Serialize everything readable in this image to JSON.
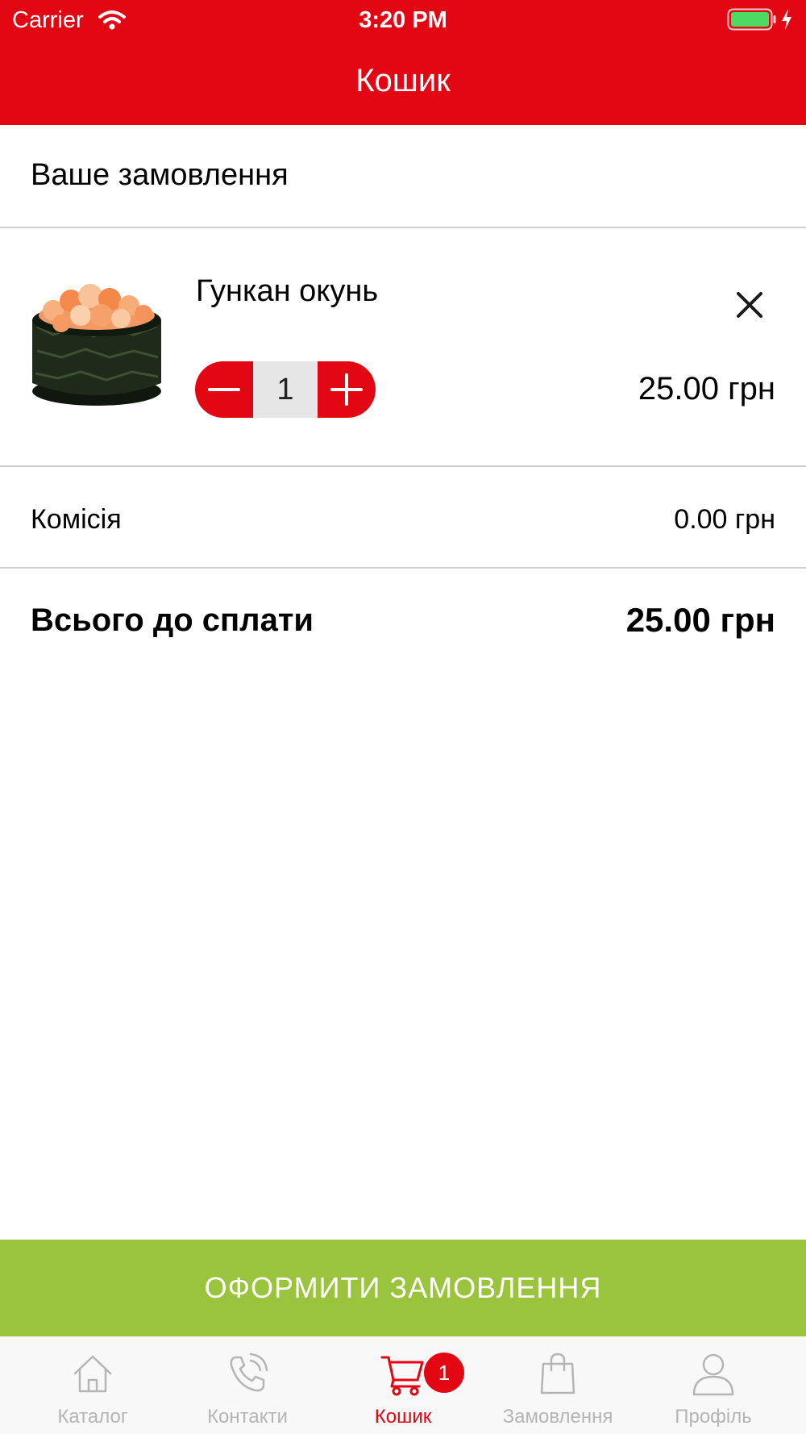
{
  "status_bar": {
    "carrier": "Carrier",
    "time": "3:20 PM",
    "battery_color": "#4cd964"
  },
  "nav": {
    "title": "Кошик"
  },
  "order": {
    "section_title": "Ваше замовлення",
    "items": [
      {
        "name": "Гункан окунь",
        "image_icon": "gunkan-sushi-photo",
        "quantity": "1",
        "price": "25.00 грн"
      }
    ]
  },
  "summary": {
    "commission_label": "Комісія",
    "commission_value": "0.00 грн",
    "total_label": "Всього до сплати",
    "total_value": "25.00 грн"
  },
  "checkout_label": "ОФОРМИТИ ЗАМОВЛЕННЯ",
  "tabs": [
    {
      "label": "Каталог",
      "icon": "home-icon",
      "active": false
    },
    {
      "label": "Контакти",
      "icon": "phone-icon",
      "active": false
    },
    {
      "label": "Кошик",
      "icon": "cart-icon",
      "active": true,
      "badge": "1"
    },
    {
      "label": "Замовлення",
      "icon": "bag-icon",
      "active": false
    },
    {
      "label": "Профіль",
      "icon": "profile-icon",
      "active": false
    }
  ],
  "colors": {
    "accent": "#e30613",
    "checkout": "#9bc43e",
    "tab_inactive": "#b5b5b5"
  }
}
